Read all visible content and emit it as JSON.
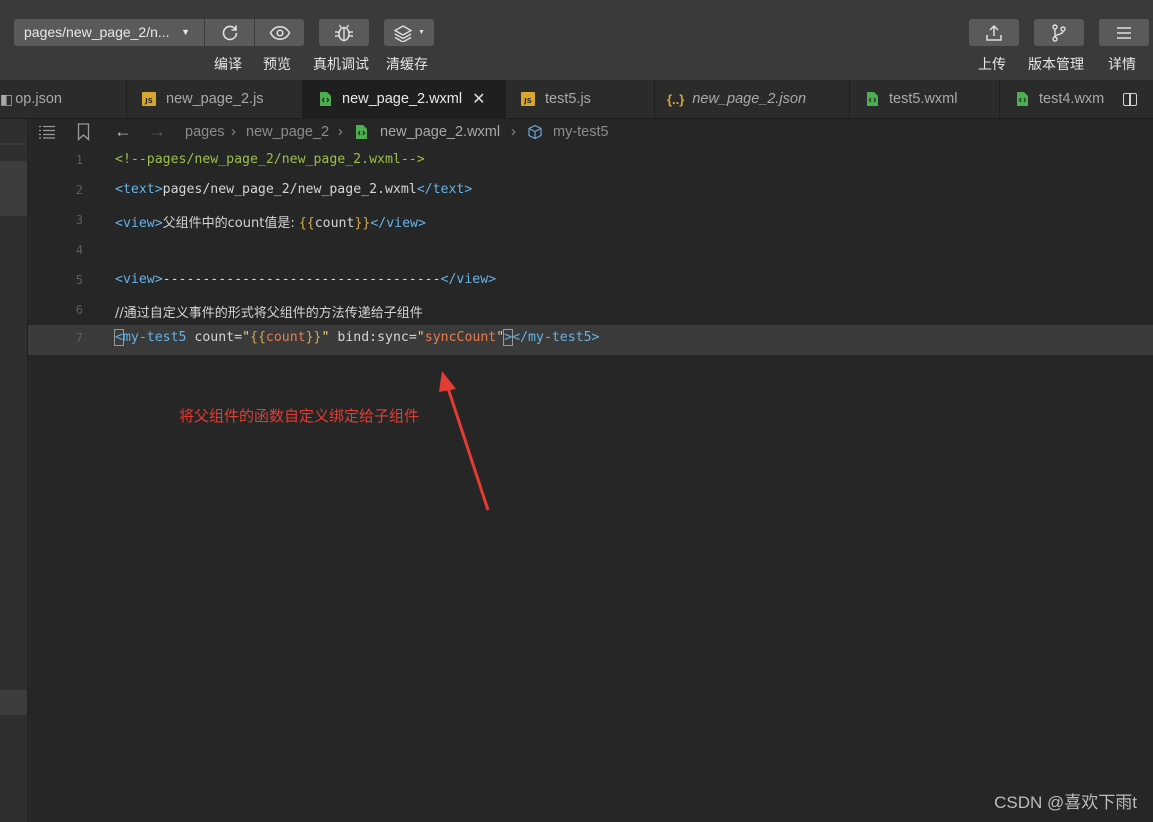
{
  "toolbar": {
    "page_select": "pages/new_page_2/n...",
    "left_labels": [
      "编译",
      "预览",
      "真机调试",
      "清缓存"
    ],
    "right_labels": [
      "上传",
      "版本管理",
      "详情"
    ]
  },
  "tabs": [
    {
      "label": "op.json",
      "icon": "arrow-left-icon",
      "active": false
    },
    {
      "label": "new_page_2.js",
      "icon": "js-file-icon",
      "active": false
    },
    {
      "label": "new_page_2.wxml",
      "icon": "wxml-file-icon",
      "active": true
    },
    {
      "label": "test5.js",
      "icon": "js-file-icon",
      "active": false
    },
    {
      "label": "new_page_2.json",
      "icon": "json-file-icon",
      "active": false
    },
    {
      "label": "test5.wxml",
      "icon": "wxml-file-icon",
      "active": false
    },
    {
      "label": "test4.wxm",
      "icon": "wxml-file-icon",
      "active": false
    }
  ],
  "breadcrumb": {
    "items": [
      "pages",
      "new_page_2",
      "new_page_2.wxml",
      "my-test5"
    ]
  },
  "code": {
    "line_numbers": [
      "1",
      "2",
      "3",
      "4",
      "5",
      "6",
      "7"
    ],
    "l1": "<!--pages/new_page_2/new_page_2.wxml-->",
    "l2_open": "<text>",
    "l2_text": "pages/new_page_2/new_page_2.wxml",
    "l2_close": "</text>",
    "l3_open": "<view>",
    "l3_text": "父组件中的count值是: ",
    "l3_m1": "{{",
    "l3_var": "count",
    "l3_m2": "}}",
    "l3_close": "</view>",
    "l5_open": "<view>",
    "l5_text": "-----------------------------------",
    "l5_close": "</view>",
    "l6": "//通过自定义事件的形式将父组件的方法传递给子组件",
    "l7_lt": "<",
    "l7_tag": "my-test5",
    "l7_attr1": " count=",
    "l7_q1": "\"",
    "l7_m1": "{{",
    "l7_var": "count",
    "l7_m2": "}}",
    "l7_q2": "\"",
    "l7_attr2": " bind:sync=",
    "l7_q3": "\"",
    "l7_val": "syncCount",
    "l7_q4": "\"",
    "l7_gt": ">",
    "l7_close": "</my-test5>"
  },
  "annotation": "将父组件的函数自定义绑定给子组件",
  "watermark": "CSDN @喜欢下雨t",
  "colors": {
    "annotation": "#e43b32",
    "comment": "#9bbf4a",
    "tag": "#64b3e8",
    "string": "#ecd37a",
    "attr_value": "#e87c4f"
  }
}
